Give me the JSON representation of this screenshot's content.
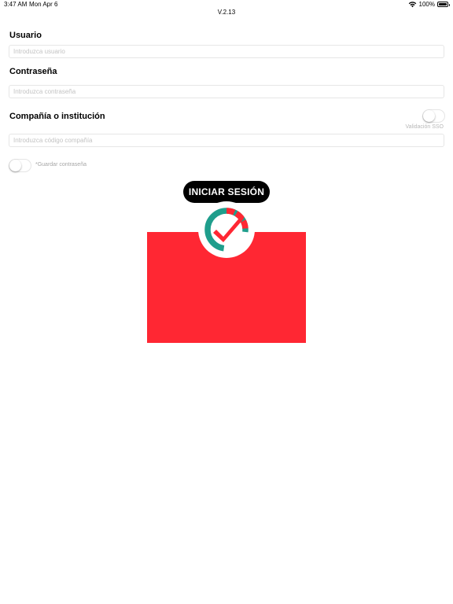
{
  "status_bar": {
    "time": "3:47 AM",
    "date": "Mon Apr 6",
    "battery": "100%"
  },
  "version": "V.2.13",
  "form": {
    "usuario": {
      "label": "Usuario",
      "placeholder": "Introduzca usuario",
      "value": ""
    },
    "contrasena": {
      "label": "Contraseña",
      "placeholder": "Introduzca contraseña",
      "value": ""
    },
    "compania": {
      "label": "Compañía o institución",
      "placeholder": "Introduzca código compañía",
      "value": ""
    },
    "sso_toggle": {
      "label": "Validación SSO",
      "on": false
    },
    "save_password_toggle": {
      "label": "*Guardar contraseña",
      "on": false
    }
  },
  "login_button": {
    "label": "INICIAR SESIÓN"
  },
  "colors": {
    "brand_red": "#ff2733",
    "brand_teal": "#1f9e8c",
    "button_black": "#000000"
  },
  "icons": [
    "wifi-icon",
    "battery-icon",
    "check-clock-logo-icon"
  ]
}
